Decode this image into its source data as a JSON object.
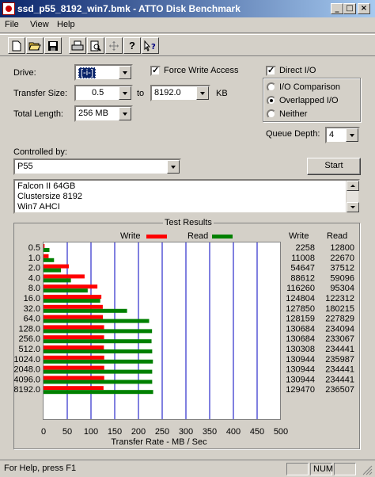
{
  "window": {
    "title": "ssd_p55_8192_win7.bmk - ATTO Disk Benchmark"
  },
  "menu": {
    "items": [
      "File",
      "View",
      "Help"
    ]
  },
  "toolbar": {
    "buttons": [
      "new-icon",
      "open-icon",
      "save-icon",
      "print-icon",
      "print-preview-icon",
      "move-icon",
      "help-icon",
      "context-help-icon"
    ]
  },
  "drive": {
    "label": "Drive:",
    "value": "[-i-]"
  },
  "force_write": {
    "label": "Force Write Access",
    "checked": true
  },
  "direct_io": {
    "label": "Direct I/O",
    "checked": true
  },
  "transfer_size": {
    "label": "Transfer Size:",
    "from": "0.5",
    "to_label": "to",
    "to": "8192.0",
    "unit": "KB"
  },
  "total_length": {
    "label": "Total Length:",
    "value": "256 MB"
  },
  "io_mode": {
    "options": [
      "I/O Comparison",
      "Overlapped I/O",
      "Neither"
    ],
    "selected": "Overlapped I/O"
  },
  "queue_depth": {
    "label": "Queue Depth:",
    "value": "4"
  },
  "controlled_by": {
    "label": "Controlled by:",
    "value": "P55"
  },
  "start_button": "Start",
  "description": [
    "Falcon II 64GB",
    "Clustersize 8192",
    "Win7 AHCI"
  ],
  "results": {
    "title": "Test Results",
    "legend_write": "Write",
    "legend_read": "Read",
    "col_write": "Write",
    "col_read": "Read"
  },
  "colors": {
    "write": "#ff0000",
    "read": "#008000",
    "grid": "#0000c0"
  },
  "chart_data": {
    "type": "bar",
    "orientation": "horizontal",
    "categories": [
      "0.5",
      "1.0",
      "2.0",
      "4.0",
      "8.0",
      "16.0",
      "32.0",
      "64.0",
      "128.0",
      "256.0",
      "512.0",
      "1024.0",
      "2048.0",
      "4096.0",
      "8192.0"
    ],
    "series": [
      {
        "name": "Write",
        "values": [
          2258,
          11008,
          54647,
          88612,
          116260,
          124804,
          127850,
          128159,
          130684,
          130684,
          130308,
          130944,
          130944,
          130944,
          129470
        ]
      },
      {
        "name": "Read",
        "values": [
          12800,
          22670,
          37512,
          59096,
          95304,
          122312,
          180215,
          227829,
          234094,
          233067,
          234441,
          235987,
          234441,
          234441,
          236507
        ]
      }
    ],
    "xlabel": "Transfer Rate - MB / Sec",
    "xlim": [
      0,
      500
    ],
    "xticks": [
      "0",
      "50",
      "100",
      "150",
      "200",
      "250",
      "300",
      "350",
      "400",
      "450",
      "500"
    ],
    "legend": "top"
  },
  "status": {
    "text": "For Help, press F1",
    "num": "NUM"
  }
}
